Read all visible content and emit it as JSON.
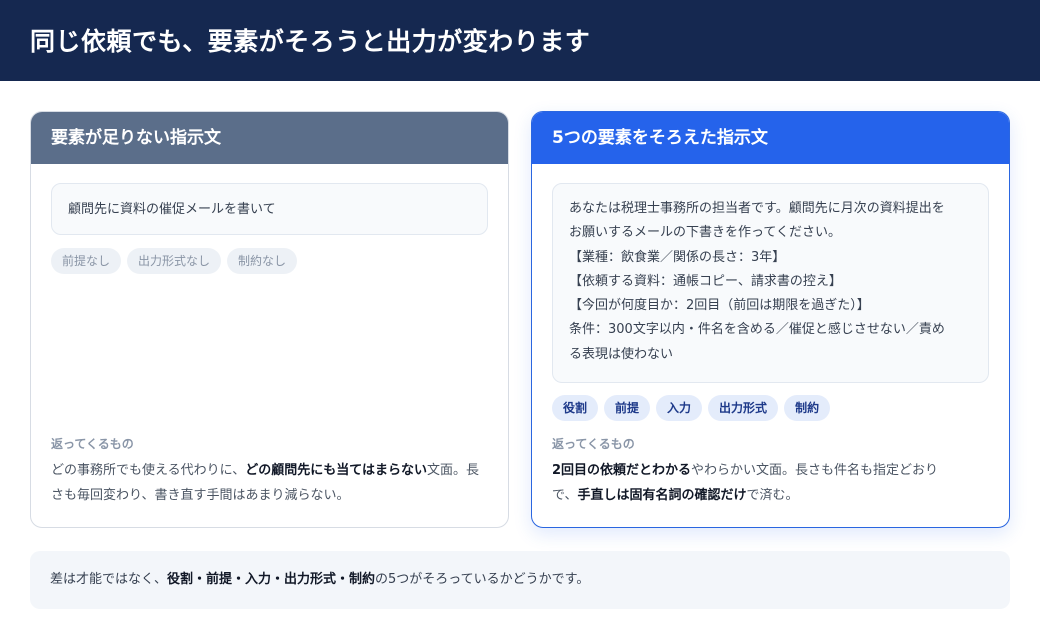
{
  "header": {
    "title": "同じ依頼でも、要素がそろうと出力が変わります"
  },
  "left_card": {
    "title": "要素が足りない指示文",
    "prompt": "顧問先に資料の催促メールを書いて",
    "tags": [
      "前提なし",
      "出力形式なし",
      "制約なし"
    ],
    "returns_label": "返ってくるもの",
    "returns": {
      "pre": "どの事務所でも使える代わりに、",
      "bold": "どの顧問先にも当てはまらない",
      "post": "文面。長さも毎回変わり、書き直す手間はあまり減らない。"
    }
  },
  "right_card": {
    "title": "5つの要素をそろえた指示文",
    "prompt_lines": [
      "あなたは税理士事務所の担当者です。顧問先に月次の資料提出を",
      "お願いするメールの下書きを作ってください。",
      "【業種：飲食業／関係の長さ：3年】",
      "【依頼する資料：通帳コピー、請求書の控え】",
      "【今回が何度目か：2回目（前回は期限を過ぎた）】",
      "条件：300文字以内・件名を含める／催促と感じさせない／責め",
      "る表現は使わない"
    ],
    "tags": [
      "役割",
      "前提",
      "入力",
      "出力形式",
      "制約"
    ],
    "returns_label": "返ってくるもの",
    "returns": {
      "bold1": "2回目の依頼だとわかる",
      "mid": "やわらかい文面。長さも件名も指定どおり",
      "mid2": "で、",
      "bold2": "手直しは固有名詞の確認だけ",
      "post": "で済む。"
    }
  },
  "footer": {
    "pre": "差は才能ではなく、",
    "bold": "役割・前提・入力・出力形式・制約",
    "post": "の5つがそろっているかどうかです。"
  },
  "colors": {
    "header_bg": "#152850",
    "left_header": "#5b6e8a",
    "right_header": "#2563eb",
    "accent_border": "#2a66e0"
  }
}
